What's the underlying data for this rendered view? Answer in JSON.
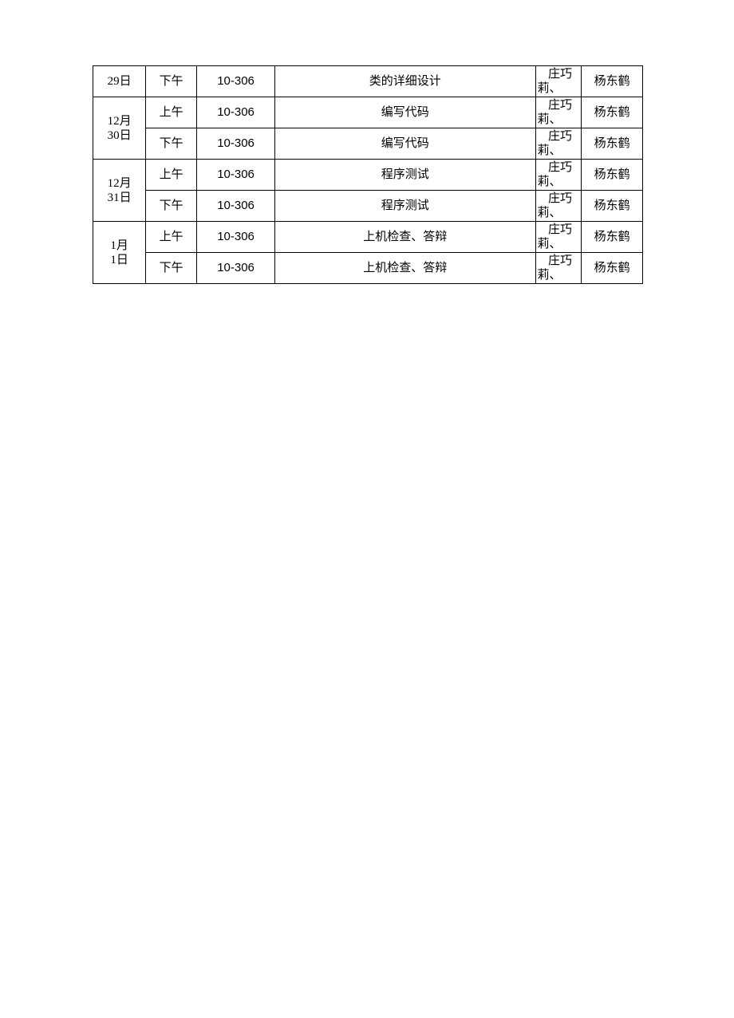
{
  "rows": [
    {
      "date": "29日",
      "ampm": "下午",
      "room": "10-306",
      "task": "类的详细设计",
      "name1a": "庄巧",
      "name1b": "莉、",
      "name2": "杨东鹤"
    },
    {
      "date": "12月\n30日",
      "ampm": "上午",
      "room": "10-306",
      "task": "编写代码",
      "name1a": "庄巧",
      "name1b": "莉、",
      "name2": "杨东鹤"
    },
    {
      "date": "",
      "ampm": "下午",
      "room": "10-306",
      "task": "编写代码",
      "name1a": "庄巧",
      "name1b": "莉、",
      "name2": "杨东鹤"
    },
    {
      "date": "12月\n31日",
      "ampm": "上午",
      "room": "10-306",
      "task": "程序测试",
      "name1a": "庄巧",
      "name1b": "莉、",
      "name2": "杨东鹤"
    },
    {
      "date": "",
      "ampm": "下午",
      "room": "10-306",
      "task": "程序测试",
      "name1a": "庄巧",
      "name1b": "莉、",
      "name2": "杨东鹤"
    },
    {
      "date": "1月\n1日",
      "ampm": "上午",
      "room": "10-306",
      "task": "上机检查、答辩",
      "name1a": "庄巧",
      "name1b": "莉、",
      "name2": "杨东鹤"
    },
    {
      "date": "",
      "ampm": "下午",
      "room": "10-306",
      "task": "上机检查、答辩",
      "name1a": "庄巧",
      "name1b": "莉、",
      "name2": "杨东鹤"
    }
  ]
}
